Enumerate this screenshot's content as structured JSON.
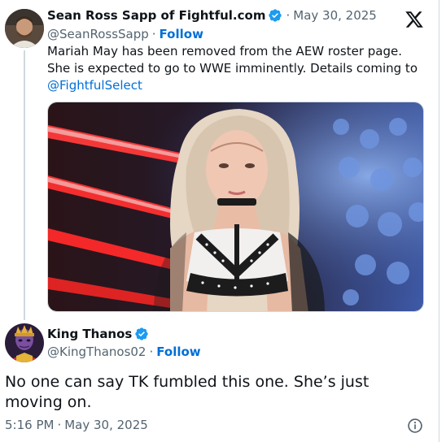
{
  "quoted_tweet": {
    "author_name": "Sean Ross Sapp of Fightful.com",
    "handle": "@SeanRossSapp",
    "follow_label": "Follow",
    "date": "May 30, 2025",
    "text_lines": [
      "Mariah May has been removed from the AEW roster page.",
      "She is expected to go to WWE imminently. Details coming to"
    ],
    "mention": "@FightfulSelect",
    "verified": true
  },
  "reply": {
    "author_name": "King Thanos",
    "handle": "@KingThanos02",
    "follow_label": "Follow",
    "text_lines": [
      "No one can say TK fumbled this one. She’s just",
      "moving on."
    ],
    "verified": true
  },
  "footer": {
    "time": "5:16 PM",
    "date": "May 30, 2025"
  },
  "separator": "·",
  "icons": {
    "brand": "x-logo-icon",
    "verified": "verified-badge-icon",
    "info": "info-icon"
  },
  "colors": {
    "accent": "#006fd6",
    "verified": "#1d9bf0",
    "muted": "#536471",
    "text": "#0f1419"
  }
}
